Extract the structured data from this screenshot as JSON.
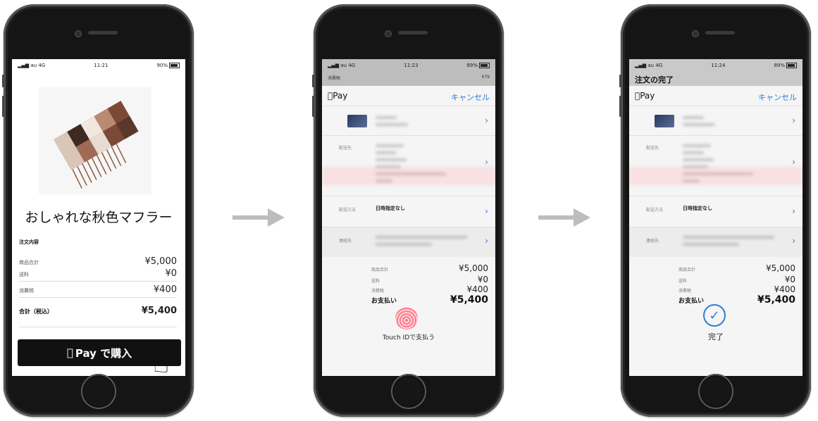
{
  "phone1": {
    "status": {
      "carrier": "au 4G",
      "time": "11:21",
      "battery": "90%"
    },
    "product_name": "おしゃれな秋色マフラー",
    "order_section": "注文内容",
    "rows": [
      {
        "label": "商品合計",
        "value": "¥5,000"
      },
      {
        "label": "送料",
        "value": "¥0"
      },
      {
        "label": "消費税",
        "value": "¥400"
      }
    ],
    "total": {
      "label": "合計（税込）",
      "value": "¥5,400"
    },
    "pay_button": "Pay で購入"
  },
  "arrows": [
    "arrow-1",
    "arrow-2"
  ],
  "phone2": {
    "status": {
      "carrier": "au 4G",
      "time": "11:23",
      "battery": "89%"
    },
    "behind": {
      "label": "消費税",
      "value": "¥79"
    },
    "sheet_title": "Pay",
    "cancel": "キャンセル",
    "ship_to_label": "配送先",
    "ship_method_label": "配送方法",
    "ship_method_value": "日時指定なし",
    "contact_label": "連絡先",
    "rows": [
      {
        "label": "商品合計",
        "value": "¥5,000"
      },
      {
        "label": "送料",
        "value": "¥0"
      },
      {
        "label": "消費税",
        "value": "¥400"
      }
    ],
    "total": {
      "label": "お支払い",
      "value": "¥5,400"
    },
    "touch_id": "Touch IDで支払う"
  },
  "phone3": {
    "status": {
      "carrier": "au 4G",
      "time": "11:24",
      "battery": "89%"
    },
    "order_title": "注文の完了",
    "sheet_title": "Pay",
    "cancel": "キャンセル",
    "ship_to_label": "配送先",
    "ship_method_label": "配送方法",
    "ship_method_value": "日時指定なし",
    "contact_label": "連絡先",
    "rows": [
      {
        "label": "商品合計",
        "value": "¥5,000"
      },
      {
        "label": "送料",
        "value": "¥0"
      },
      {
        "label": "消費税",
        "value": "¥400"
      }
    ],
    "total": {
      "label": "お支払い",
      "value": "¥5,400"
    },
    "done": "完了"
  },
  "colors": {
    "accent": "#2f7bd8",
    "button": "#111111",
    "arrow": "#bdbdbd"
  }
}
